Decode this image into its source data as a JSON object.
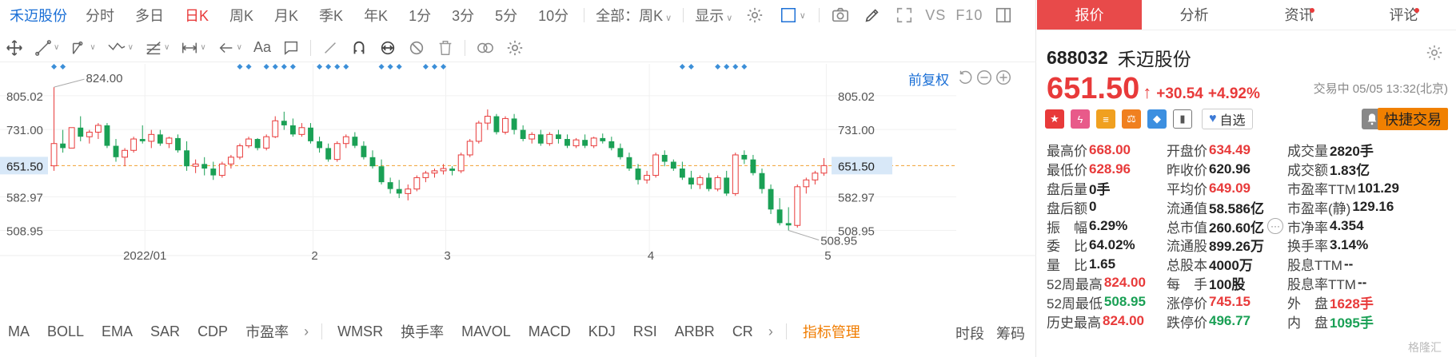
{
  "topbar": {
    "stock_name": "禾迈股份",
    "periods": [
      "分时",
      "多日",
      "日K",
      "周K",
      "月K",
      "季K",
      "年K",
      "1分",
      "3分",
      "5分",
      "10分"
    ],
    "active_period": "日K",
    "range_select": "全部：周K",
    "display_select": "显示",
    "vs_label": "VS",
    "f10_label": "F10"
  },
  "toolbar": {
    "text_tool": "Aa"
  },
  "chart_header": {
    "fq_label": "前复权"
  },
  "chart_data": {
    "type": "candlestick",
    "y_ticks": [
      "805.02",
      "731.00",
      "651.50",
      "582.97",
      "508.95"
    ],
    "x_ticks": [
      "2022/01",
      "2",
      "3",
      "4",
      "5"
    ],
    "current_price_label": "651.50",
    "max_label": "824.00",
    "min_label": "508.95",
    "ylim": [
      480,
      840
    ],
    "grid": true,
    "colors": {
      "up": "#e83a3a",
      "down": "#1aa055",
      "marker": "#3c8fd8",
      "price_line": "#f0a030"
    },
    "candles": [
      {
        "o": 651,
        "h": 824,
        "l": 640,
        "c": 700
      },
      {
        "o": 700,
        "h": 730,
        "l": 680,
        "c": 690
      },
      {
        "o": 690,
        "h": 735,
        "l": 690,
        "c": 735
      },
      {
        "o": 735,
        "h": 760,
        "l": 705,
        "c": 715
      },
      {
        "o": 715,
        "h": 730,
        "l": 700,
        "c": 725
      },
      {
        "o": 725,
        "h": 745,
        "l": 710,
        "c": 740
      },
      {
        "o": 740,
        "h": 745,
        "l": 690,
        "c": 695
      },
      {
        "o": 695,
        "h": 710,
        "l": 660,
        "c": 670
      },
      {
        "o": 670,
        "h": 690,
        "l": 650,
        "c": 685
      },
      {
        "o": 685,
        "h": 715,
        "l": 680,
        "c": 710
      },
      {
        "o": 710,
        "h": 740,
        "l": 700,
        "c": 705
      },
      {
        "o": 705,
        "h": 730,
        "l": 690,
        "c": 720
      },
      {
        "o": 720,
        "h": 730,
        "l": 695,
        "c": 700
      },
      {
        "o": 700,
        "h": 715,
        "l": 690,
        "c": 712
      },
      {
        "o": 712,
        "h": 720,
        "l": 680,
        "c": 685
      },
      {
        "o": 685,
        "h": 705,
        "l": 640,
        "c": 650
      },
      {
        "o": 650,
        "h": 665,
        "l": 635,
        "c": 655
      },
      {
        "o": 655,
        "h": 670,
        "l": 630,
        "c": 645
      },
      {
        "o": 645,
        "h": 660,
        "l": 620,
        "c": 630
      },
      {
        "o": 630,
        "h": 660,
        "l": 625,
        "c": 655
      },
      {
        "o": 655,
        "h": 675,
        "l": 645,
        "c": 670
      },
      {
        "o": 670,
        "h": 700,
        "l": 665,
        "c": 695
      },
      {
        "o": 695,
        "h": 715,
        "l": 690,
        "c": 710
      },
      {
        "o": 710,
        "h": 712,
        "l": 685,
        "c": 690
      },
      {
        "o": 690,
        "h": 720,
        "l": 685,
        "c": 715
      },
      {
        "o": 715,
        "h": 760,
        "l": 712,
        "c": 750
      },
      {
        "o": 750,
        "h": 770,
        "l": 730,
        "c": 740
      },
      {
        "o": 740,
        "h": 755,
        "l": 715,
        "c": 720
      },
      {
        "o": 720,
        "h": 745,
        "l": 715,
        "c": 735
      },
      {
        "o": 735,
        "h": 745,
        "l": 700,
        "c": 705
      },
      {
        "o": 705,
        "h": 715,
        "l": 680,
        "c": 690
      },
      {
        "o": 690,
        "h": 700,
        "l": 660,
        "c": 665
      },
      {
        "o": 665,
        "h": 705,
        "l": 660,
        "c": 700
      },
      {
        "o": 700,
        "h": 720,
        "l": 690,
        "c": 715
      },
      {
        "o": 715,
        "h": 725,
        "l": 690,
        "c": 695
      },
      {
        "o": 695,
        "h": 705,
        "l": 665,
        "c": 670
      },
      {
        "o": 670,
        "h": 685,
        "l": 645,
        "c": 650
      },
      {
        "o": 650,
        "h": 665,
        "l": 610,
        "c": 615
      },
      {
        "o": 615,
        "h": 625,
        "l": 590,
        "c": 600
      },
      {
        "o": 600,
        "h": 620,
        "l": 580,
        "c": 590
      },
      {
        "o": 590,
        "h": 610,
        "l": 575,
        "c": 600
      },
      {
        "o": 600,
        "h": 630,
        "l": 595,
        "c": 625
      },
      {
        "o": 625,
        "h": 640,
        "l": 615,
        "c": 635
      },
      {
        "o": 635,
        "h": 645,
        "l": 625,
        "c": 640
      },
      {
        "o": 640,
        "h": 655,
        "l": 632,
        "c": 645
      },
      {
        "o": 645,
        "h": 650,
        "l": 630,
        "c": 640
      },
      {
        "o": 640,
        "h": 680,
        "l": 635,
        "c": 675
      },
      {
        "o": 675,
        "h": 710,
        "l": 670,
        "c": 705
      },
      {
        "o": 705,
        "h": 750,
        "l": 700,
        "c": 745
      },
      {
        "o": 745,
        "h": 775,
        "l": 730,
        "c": 760
      },
      {
        "o": 760,
        "h": 765,
        "l": 720,
        "c": 725
      },
      {
        "o": 725,
        "h": 760,
        "l": 720,
        "c": 755
      },
      {
        "o": 755,
        "h": 765,
        "l": 720,
        "c": 730
      },
      {
        "o": 730,
        "h": 740,
        "l": 705,
        "c": 710
      },
      {
        "o": 710,
        "h": 725,
        "l": 700,
        "c": 720
      },
      {
        "o": 720,
        "h": 730,
        "l": 695,
        "c": 700
      },
      {
        "o": 700,
        "h": 725,
        "l": 695,
        "c": 720
      },
      {
        "o": 720,
        "h": 730,
        "l": 700,
        "c": 710
      },
      {
        "o": 710,
        "h": 720,
        "l": 690,
        "c": 695
      },
      {
        "o": 695,
        "h": 712,
        "l": 690,
        "c": 708
      },
      {
        "o": 708,
        "h": 720,
        "l": 690,
        "c": 695
      },
      {
        "o": 695,
        "h": 715,
        "l": 690,
        "c": 712
      },
      {
        "o": 712,
        "h": 722,
        "l": 700,
        "c": 705
      },
      {
        "o": 705,
        "h": 715,
        "l": 685,
        "c": 690
      },
      {
        "o": 690,
        "h": 700,
        "l": 665,
        "c": 670
      },
      {
        "o": 670,
        "h": 680,
        "l": 640,
        "c": 645
      },
      {
        "o": 645,
        "h": 655,
        "l": 610,
        "c": 620
      },
      {
        "o": 620,
        "h": 640,
        "l": 612,
        "c": 630
      },
      {
        "o": 630,
        "h": 680,
        "l": 625,
        "c": 675
      },
      {
        "o": 675,
        "h": 685,
        "l": 650,
        "c": 660
      },
      {
        "o": 660,
        "h": 665,
        "l": 640,
        "c": 645
      },
      {
        "o": 645,
        "h": 660,
        "l": 620,
        "c": 625
      },
      {
        "o": 625,
        "h": 640,
        "l": 600,
        "c": 610
      },
      {
        "o": 610,
        "h": 630,
        "l": 600,
        "c": 625
      },
      {
        "o": 625,
        "h": 635,
        "l": 595,
        "c": 600
      },
      {
        "o": 600,
        "h": 630,
        "l": 595,
        "c": 625
      },
      {
        "o": 625,
        "h": 640,
        "l": 585,
        "c": 590
      },
      {
        "o": 590,
        "h": 680,
        "l": 585,
        "c": 675
      },
      {
        "o": 675,
        "h": 685,
        "l": 655,
        "c": 665
      },
      {
        "o": 665,
        "h": 675,
        "l": 630,
        "c": 635
      },
      {
        "o": 635,
        "h": 645,
        "l": 590,
        "c": 600
      },
      {
        "o": 600,
        "h": 610,
        "l": 545,
        "c": 555
      },
      {
        "o": 555,
        "h": 580,
        "l": 520,
        "c": 525
      },
      {
        "o": 525,
        "h": 560,
        "l": 508.95,
        "c": 520
      },
      {
        "o": 520,
        "h": 610,
        "l": 515,
        "c": 605
      },
      {
        "o": 605,
        "h": 625,
        "l": 590,
        "c": 620
      },
      {
        "o": 620,
        "h": 640,
        "l": 610,
        "c": 635
      },
      {
        "o": 635,
        "h": 668,
        "l": 628.96,
        "c": 651.5
      }
    ]
  },
  "indicators": {
    "items": [
      "MA",
      "BOLL",
      "EMA",
      "SAR",
      "CDP",
      "市盈率",
      "WMSR",
      "换手率",
      "MAVOL",
      "MACD",
      "KDJ",
      "RSI",
      "ARBR",
      "CR"
    ],
    "manage": "指标管理",
    "right": [
      "时段",
      "筹码"
    ]
  },
  "tabs": [
    {
      "label": "报价",
      "active": true,
      "dot": false
    },
    {
      "label": "分析",
      "active": false,
      "dot": false
    },
    {
      "label": "资讯",
      "active": false,
      "dot": true
    },
    {
      "label": "评论",
      "active": false,
      "dot": true
    }
  ],
  "quote": {
    "code": "688032",
    "name": "禾迈股份",
    "price": "651.50",
    "change": "+30.54",
    "change_pct": "+4.92%",
    "status": "交易中 05/05 13:32(北京)",
    "watch_label": "自选",
    "trade_button": "快捷交易"
  },
  "stats": [
    [
      {
        "label": "最高价",
        "value": "668.00",
        "color": "red"
      },
      {
        "label": "开盘价",
        "value": "634.49",
        "color": "red"
      },
      {
        "label": "成交量",
        "value": "2820手",
        "color": "dark"
      }
    ],
    [
      {
        "label": "最低价",
        "value": "628.96",
        "color": "red"
      },
      {
        "label": "昨收价",
        "value": "620.96",
        "color": "dark"
      },
      {
        "label": "成交额",
        "value": "1.83亿",
        "color": "dark"
      }
    ],
    [
      {
        "label": "盘后量",
        "value": "0手",
        "color": "dark"
      },
      {
        "label": "平均价",
        "value": "649.09",
        "color": "red"
      },
      {
        "label": "市盈率TTM",
        "value": "101.29",
        "color": "dark"
      }
    ],
    [
      {
        "label": "盘后额",
        "value": "0",
        "color": "dark"
      },
      {
        "label": "流通值",
        "value": "58.586亿",
        "color": "dark"
      },
      {
        "label": "市盈率(静)",
        "value": "129.16",
        "color": "dark"
      }
    ],
    [
      {
        "label": "振　幅",
        "value": "6.29%",
        "color": "dark"
      },
      {
        "label": "总市值",
        "value": "260.60亿",
        "color": "dark",
        "more": true
      },
      {
        "label": "市净率",
        "value": "4.354",
        "color": "dark"
      }
    ],
    [
      {
        "label": "委　比",
        "value": "64.02%",
        "color": "dark"
      },
      {
        "label": "流通股",
        "value": "899.26万",
        "color": "dark"
      },
      {
        "label": "换手率",
        "value": "3.14%",
        "color": "dark"
      }
    ],
    [
      {
        "label": "量　比",
        "value": "1.65",
        "color": "dark"
      },
      {
        "label": "总股本",
        "value": "4000万",
        "color": "dark"
      },
      {
        "label": "股息TTM",
        "value": "--",
        "color": "dark"
      }
    ],
    [
      {
        "label": "52周最高",
        "value": "824.00",
        "color": "red"
      },
      {
        "label": "每　手",
        "value": "100股",
        "color": "dark"
      },
      {
        "label": "股息率TTM",
        "value": "--",
        "color": "dark"
      }
    ],
    [
      {
        "label": "52周最低",
        "value": "508.95",
        "color": "green"
      },
      {
        "label": "涨停价",
        "value": "745.15",
        "color": "red"
      },
      {
        "label": "外　盘",
        "value": "1628手",
        "color": "red"
      }
    ],
    [
      {
        "label": "历史最高",
        "value": "824.00",
        "color": "red"
      },
      {
        "label": "跌停价",
        "value": "496.77",
        "color": "green"
      },
      {
        "label": "内　盘",
        "value": "1095手",
        "color": "green"
      }
    ]
  ],
  "watermark": "格隆汇"
}
